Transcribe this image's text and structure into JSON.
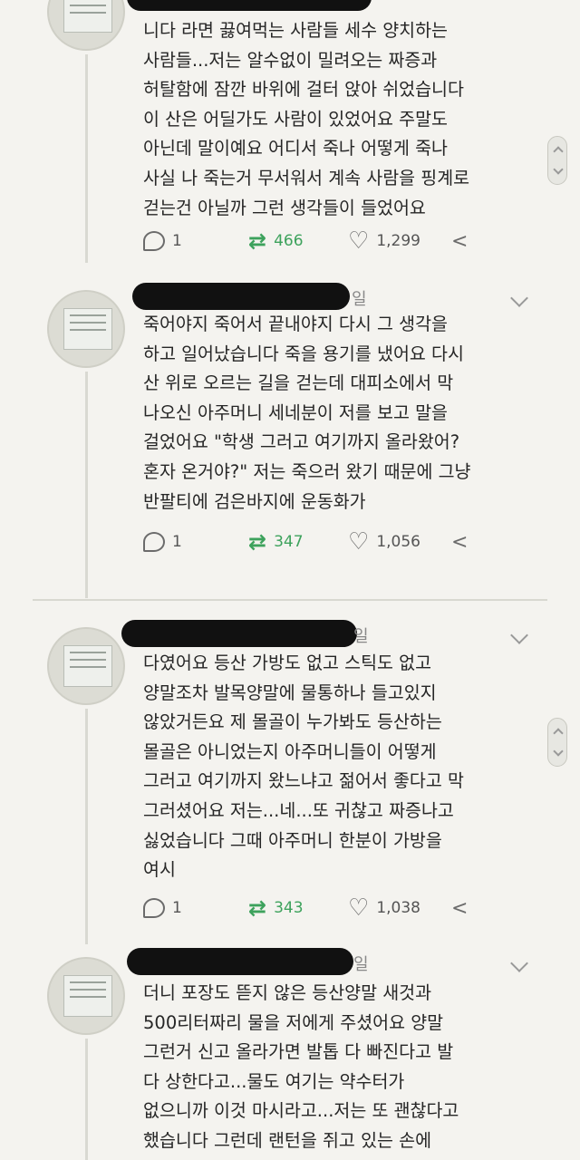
{
  "tweets": [
    {
      "date_suffix": "",
      "lines": [
        "니다 라면 끓여먹는 사람들 세수 양치하는",
        "사람들...저는 알수없이 밀려오는 짜증과",
        "허탈함에 잠깐 바위에 걸터 앉아 쉬었습니다",
        "이 산은 어딜가도 사람이 있었어요 주말도",
        "아닌데 말이예요 어디서 죽나 어떻게 죽나",
        "사실 나 죽는거 무서워서 계속 사람을 핑계로",
        "걷는건 아닐까 그런 생각들이 들었어요"
      ],
      "replies": "1",
      "retweets": "466",
      "likes": "1,299"
    },
    {
      "date_suffix": "일",
      "lines": [
        "죽어야지 죽어서 끝내야지 다시 그 생각을",
        "하고 일어났습니다 죽을 용기를 냈어요 다시",
        "산 위로 오르는 길을 걷는데 대피소에서 막",
        "나오신 아주머니 세네분이 저를 보고 말을",
        "걸었어요 \"학생 그러고 여기까지 올라왔어?",
        "혼자 온거야?\" 저는 죽으러 왔기 때문에 그냥",
        "반팔티에 검은바지에 운동화가"
      ],
      "replies": "1",
      "retweets": "347",
      "likes": "1,056"
    },
    {
      "date_suffix": "일",
      "lines": [
        "다였어요 등산 가방도 없고 스틱도 없고",
        "양말조차 발목양말에 물통하나 들고있지",
        "않았거든요 제 몰골이 누가봐도 등산하는",
        "몰골은 아니었는지 아주머니들이 어떻게",
        "그러고 여기까지 왔느냐고 젊어서 좋다고 막",
        "그러셨어요 저는...네...또 귀찮고 짜증나고",
        "싫었습니다 그때 아주머니 한분이 가방을",
        "여시"
      ],
      "replies": "1",
      "retweets": "343",
      "likes": "1,038"
    },
    {
      "date_suffix": "일",
      "lines": [
        "더니 포장도 뜯지 않은 등산양말 새것과",
        "500리터짜리 물을 저에게 주셨어요 양말",
        "그런거 신고 올라가면 발톱 다 빠진다고 발",
        "다 상한다고...물도 여기는 약수터가",
        "없으니까 이것 마시라고...저는 또 괜찮다고",
        "했습니다 그런데 랜턴을 쥐고 있는 손에"
      ],
      "replies": "",
      "retweets": "",
      "likes": ""
    }
  ],
  "icons": {
    "reply": "reply-icon",
    "retweet": "retweet-icon",
    "like": "heart-icon",
    "share": "share-icon",
    "more": "chevron-down-icon"
  },
  "colors": {
    "background": "#f4f3ef",
    "retweet": "#3da25c",
    "text": "#262626",
    "muted": "#6b6b6b"
  }
}
